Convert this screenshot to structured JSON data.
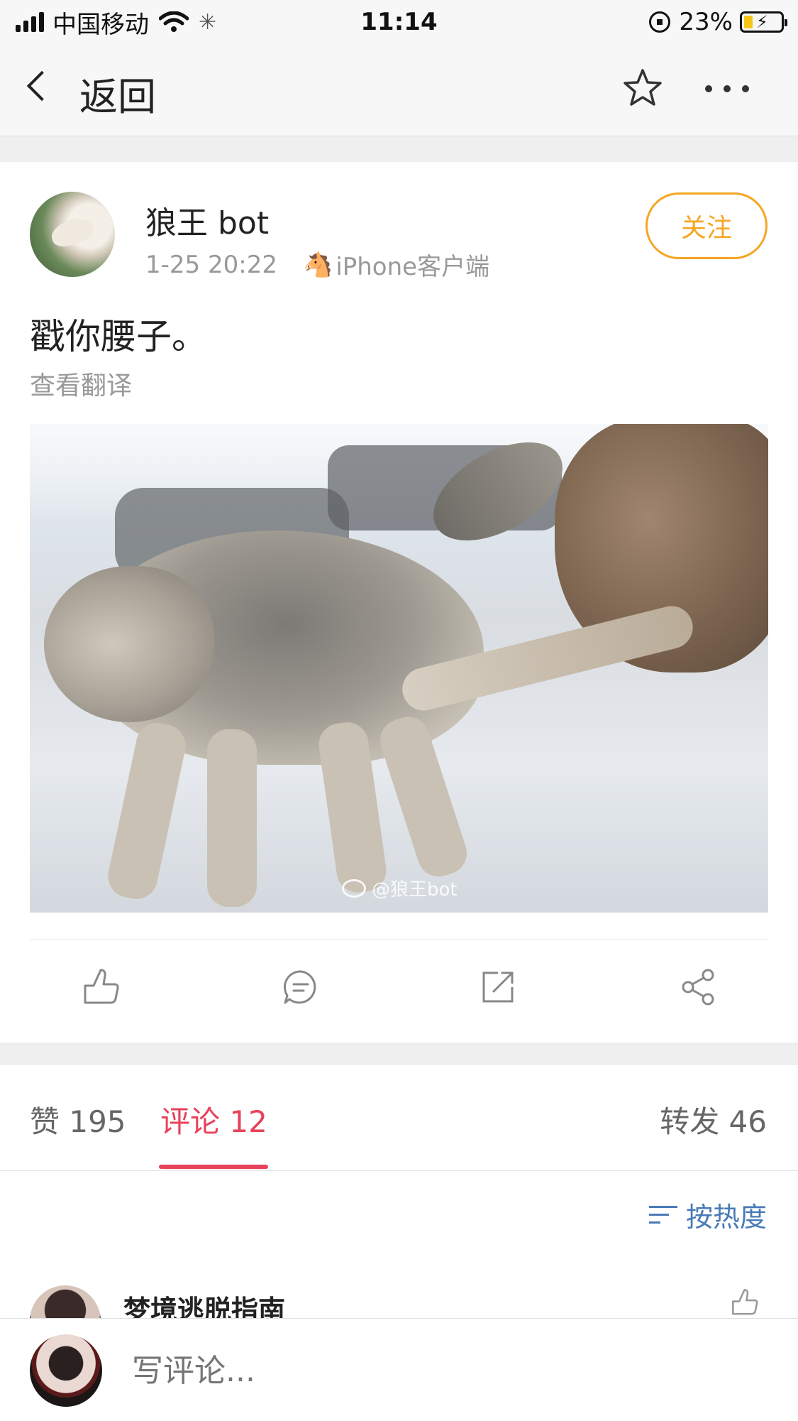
{
  "status_bar": {
    "carrier": "中国移动",
    "time": "11:14",
    "battery_percent": "23%",
    "battery_level": 0.23
  },
  "navbar": {
    "back_label": "返回"
  },
  "post": {
    "author": "狼王 bot",
    "timestamp": "1-25 20:22",
    "source": "iPhone客户端",
    "follow_label": "关注",
    "text": "戳你腰子。",
    "translate_label": "查看翻译",
    "image_watermark": "@狼王bot"
  },
  "actions": {
    "icons": [
      "thumbs-up-icon",
      "comment-icon",
      "repost-icon",
      "share-icon"
    ]
  },
  "tabs": {
    "likes": "赞 195",
    "comments": "评论 12",
    "reposts": "转发 46",
    "active": "comments",
    "accent_color": "#e8425a"
  },
  "sort": {
    "label": "按热度"
  },
  "first_comment": {
    "author": "梦境逃脱指南"
  },
  "comment_bar": {
    "placeholder": "写评论..."
  },
  "colors": {
    "follow": "#f5a623",
    "sort_link": "#4a7bb7"
  }
}
